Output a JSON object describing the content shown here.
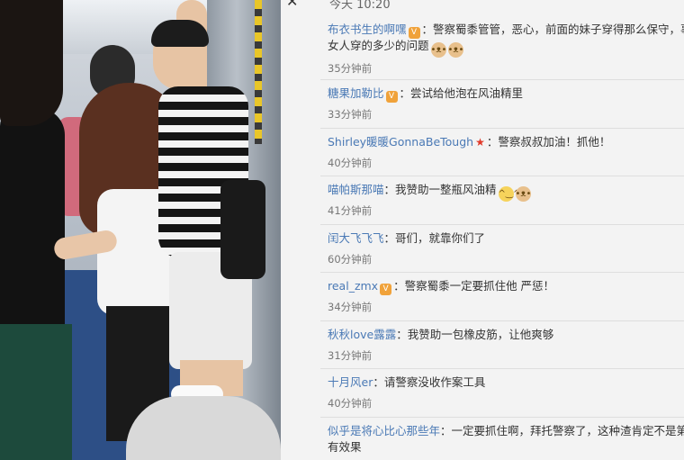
{
  "status_bar": {
    "icon": "close-icon",
    "time": "今天 10:20"
  },
  "comments": [
    {
      "user": "布衣书生的啊嘿",
      "badge": true,
      "text": "：警察蜀黍管管，恶心，前面的妹子穿得那么保守，事实证明这根本不是",
      "text2": "女人穿的多少的问题",
      "emoji": [
        "dog",
        "dog"
      ],
      "time": "35分钟前"
    },
    {
      "user": "糖果加勒比",
      "badge": true,
      "text": "：尝试给他泡在风油精里",
      "time": "33分钟前"
    },
    {
      "user": "Shirley暖暖GonnaBeTough",
      "star": true,
      "text": "：警察叔叔加油！抓他！",
      "time": "40分钟前"
    },
    {
      "user": "喵帕斯那喵",
      "text": "：我赞助一整瓶风油精",
      "emoji": [
        "smile",
        "dog"
      ],
      "time": "41分钟前"
    },
    {
      "user": "闰大飞飞飞",
      "text": "：哥们，就靠你们了",
      "time": "60分钟前"
    },
    {
      "user": "real_zmx",
      "badge": true,
      "text": "：警察蜀黍一定要抓住他 严惩！",
      "time": "34分钟前"
    },
    {
      "user": "秋秋love露露",
      "text": "：我赞助一包橡皮筋，让他爽够",
      "time": "31分钟前"
    },
    {
      "user": "十月风er",
      "text": "：请警察没收作案工具",
      "time": "40分钟前"
    },
    {
      "user": "似乎是将心比心那些年",
      "text": "：一定要抓住啊，拜托警察了，这种渣肯定不是第一次了",
      "text2": "有效果"
    }
  ],
  "colors": {
    "username": "#4a79b5",
    "text": "#333333",
    "meta": "#777777",
    "panel_bg": "#f3f3f3"
  }
}
